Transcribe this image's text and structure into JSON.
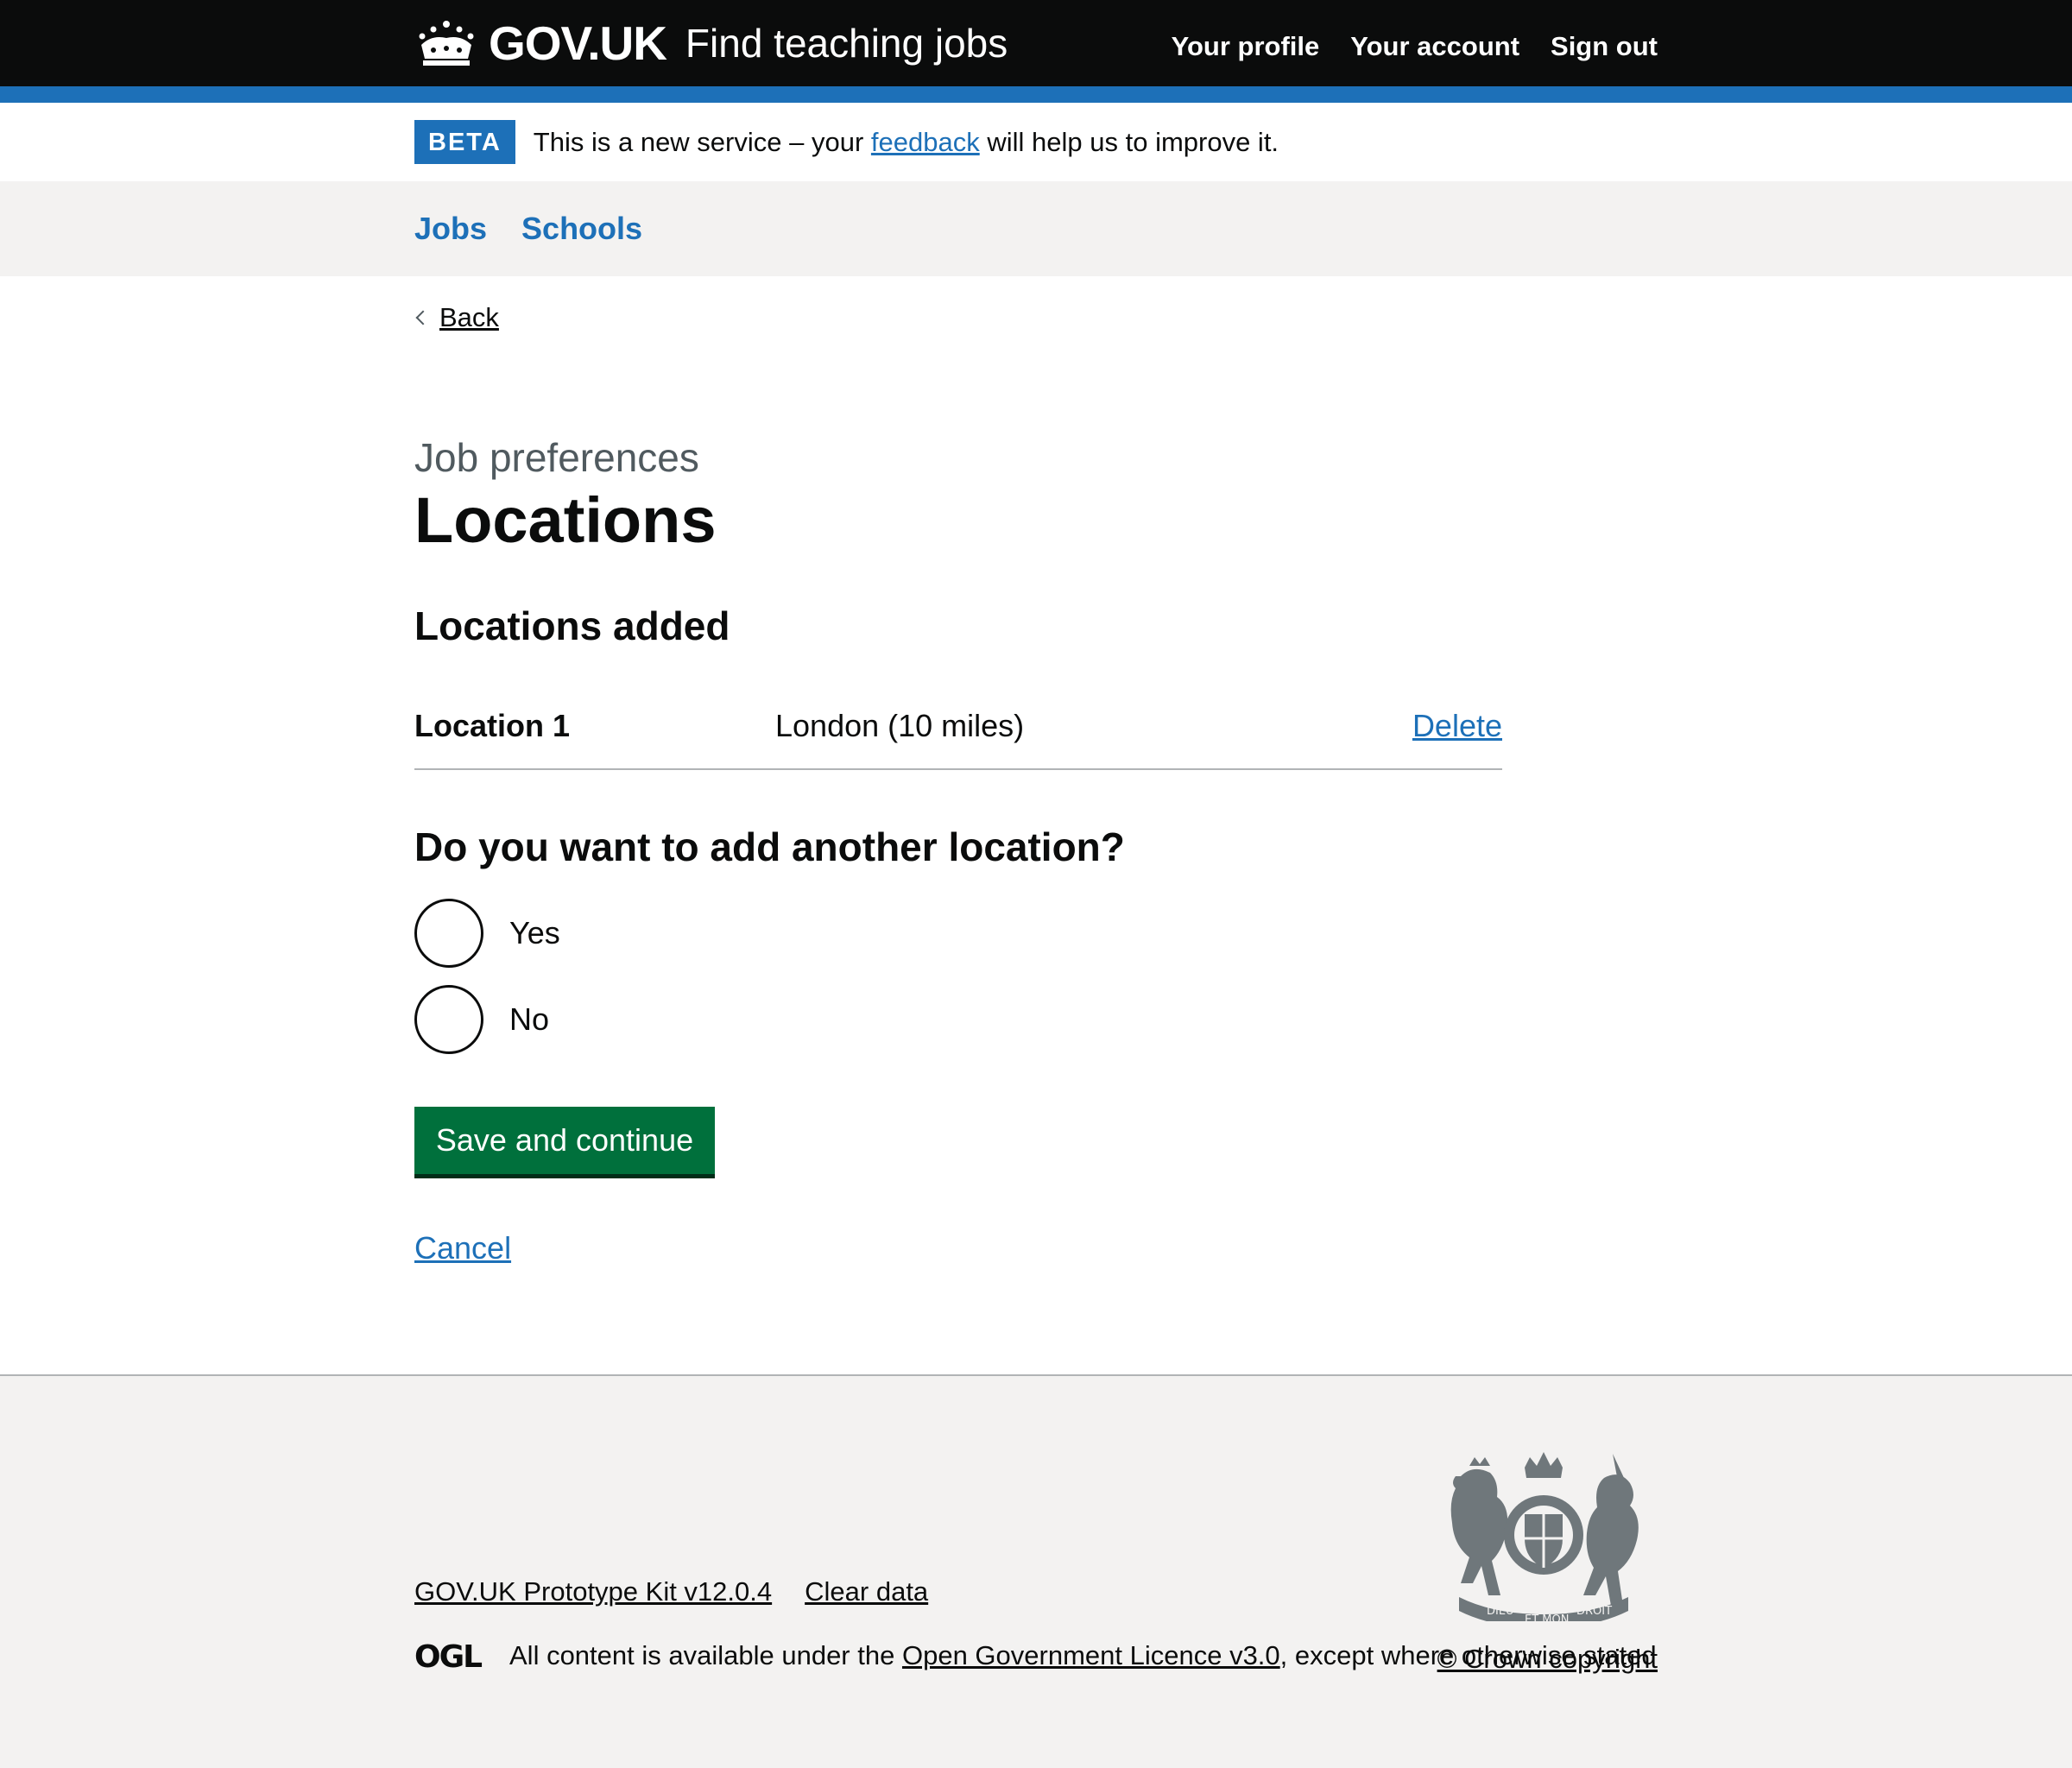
{
  "header": {
    "logo_text": "GOV.UK",
    "service_name": "Find teaching jobs",
    "nav": [
      {
        "label": "Your profile"
      },
      {
        "label": "Your account"
      },
      {
        "label": "Sign out"
      }
    ]
  },
  "beta": {
    "tag": "BETA",
    "text_before": "This is a new service – your",
    "link": "feedback",
    "text_after": "will help us to improve it."
  },
  "service_nav": {
    "items": [
      {
        "label": "Jobs"
      },
      {
        "label": "Schools"
      }
    ]
  },
  "main": {
    "back_label": "Back",
    "caption": "Job preferences",
    "title": "Locations",
    "section_title": "Locations added",
    "locations": [
      {
        "key": "Location 1",
        "value": "London (10 miles)",
        "action": "Delete"
      }
    ],
    "question": "Do you want to add another location?",
    "options": [
      {
        "label": "Yes",
        "selected": false
      },
      {
        "label": "No",
        "selected": false
      }
    ],
    "submit_label": "Save and continue",
    "cancel_label": "Cancel"
  },
  "footer": {
    "links": [
      {
        "label": "GOV.UK Prototype Kit v12.0.4"
      },
      {
        "label": "Clear data"
      }
    ],
    "licence_before": "All content is available under the",
    "licence_link": "Open Government Licence v3.0",
    "licence_after": ", except where otherwise stated",
    "copyright": "© Crown copyright",
    "ogl_logo_text": "OGL",
    "crest_motto": [
      "DIEU",
      "ET MON",
      "DROIT"
    ]
  },
  "colors": {
    "header_bg": "#0b0c0c",
    "link": "#1d70b8",
    "button": "#00703c",
    "footer_bg": "#f3f2f1"
  }
}
